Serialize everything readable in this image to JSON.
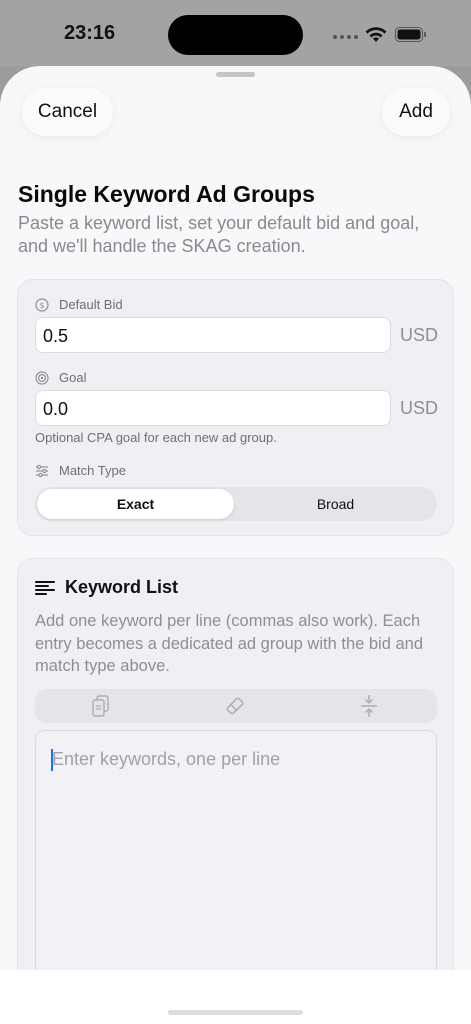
{
  "status": {
    "time": "23:16"
  },
  "nav": {
    "cancel_label": "Cancel",
    "add_label": "Add"
  },
  "header": {
    "title": "Single Keyword Ad Groups",
    "subtitle": "Paste a keyword list, set your default bid and goal, and we'll handle the SKAG creation."
  },
  "settings": {
    "default_bid": {
      "label": "Default Bid",
      "value": "0.5",
      "unit": "USD",
      "icon": "dollar-circle-icon"
    },
    "goal": {
      "label": "Goal",
      "value": "0.0",
      "unit": "USD",
      "icon": "target-icon",
      "hint": "Optional CPA goal for each new ad group."
    },
    "match_type": {
      "label": "Match Type",
      "icon": "sliders-icon",
      "options": [
        "Exact",
        "Broad"
      ],
      "selected": "Exact"
    }
  },
  "keywords": {
    "title": "Keyword List",
    "icon": "text-lines-icon",
    "description": "Add one keyword per line (commas also work). Each entry becomes a dedicated ad group with the bid and match type above.",
    "toolbar_icons": [
      "paste-icon",
      "eraser-icon",
      "compress-icon"
    ],
    "placeholder": "Enter keywords, one per line"
  },
  "colors": {
    "accent": "#1a73e8",
    "background": "#f8f8fa",
    "card": "#f0f0f4"
  }
}
